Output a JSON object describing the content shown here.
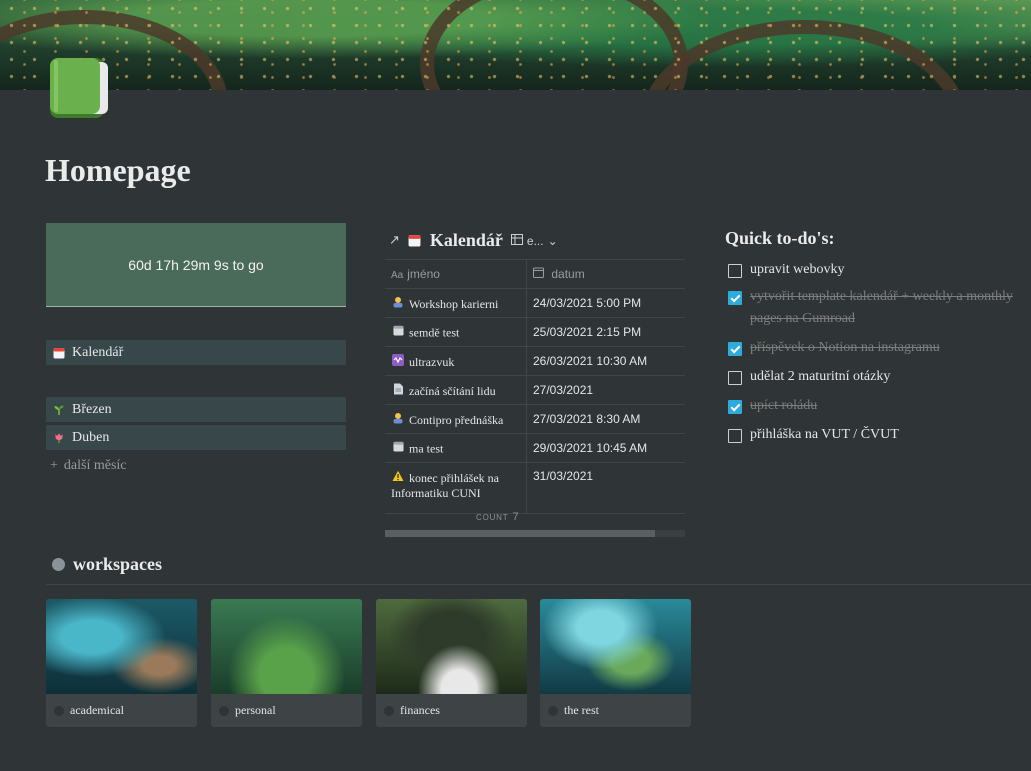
{
  "page": {
    "title": "Homepage"
  },
  "countdown": {
    "text": "60d 17h 29m 9s to go"
  },
  "left_links": [
    {
      "label": "Kalendář",
      "icon": "calendar-icon"
    },
    {
      "label": "Březen",
      "icon": "seedling-icon"
    },
    {
      "label": "Duben",
      "icon": "tulip-icon"
    }
  ],
  "add_month": {
    "label": "další měsíc"
  },
  "calendar": {
    "title": "Kalendář",
    "view_label": "e...",
    "columns": [
      "jméno",
      "datum"
    ],
    "rows": [
      {
        "name": "Workshop karierni",
        "date": "24/03/2021 5:00 PM",
        "icon": "person-icon"
      },
      {
        "name": "semdě test",
        "date": "25/03/2021 2:15 PM",
        "icon": "calendar-icon"
      },
      {
        "name": "ultrazvuk",
        "date": "26/03/2021 10:30 AM",
        "icon": "wave-icon"
      },
      {
        "name": "začíná sčítání lidu",
        "date": "27/03/2021",
        "icon": "page-icon"
      },
      {
        "name": "Contipro přednáška",
        "date": "27/03/2021 8:30 AM",
        "icon": "person-icon"
      },
      {
        "name": "ma test",
        "date": "29/03/2021 10:45 AM",
        "icon": "calendar-icon"
      },
      {
        "name": "konec přihlášek na Informatiku CUNI",
        "date": "31/03/2021",
        "icon": "warning-icon"
      }
    ],
    "count_label": "COUNT",
    "count_value": "7"
  },
  "todo": {
    "title": "Quick to-do's:",
    "items": [
      {
        "text": "upravit webovky",
        "done": false
      },
      {
        "text": "vytvořit template kalendář + weekly a monthly pages na Gumroad",
        "done": true
      },
      {
        "text": "příspěvek o Notion na instagramu",
        "done": true
      },
      {
        "text": "udělat 2 maturitní otázky",
        "done": false
      },
      {
        "text": "upíct roládu",
        "done": true
      },
      {
        "text": "přihláška na VUT / ČVUT",
        "done": false
      }
    ]
  },
  "workspaces": {
    "title": "workspaces",
    "cards": [
      {
        "label": "academical"
      },
      {
        "label": "personal"
      },
      {
        "label": "finances"
      },
      {
        "label": "the rest"
      }
    ]
  },
  "colors": {
    "background": "#2f3437",
    "accent_check": "#2eaadc",
    "countdown_bg": "#4a6b5a"
  }
}
